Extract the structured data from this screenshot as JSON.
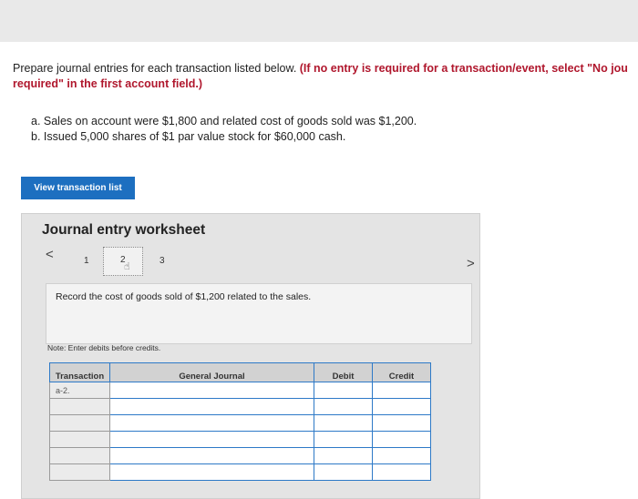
{
  "instructions": {
    "text": "Prepare journal entries for each transaction listed below. ",
    "emphasis_line1": "(If no entry is required for a transaction/event, select \"No jou",
    "emphasis_line2": "required\" in the first account field.)"
  },
  "transactions": [
    "a. Sales on account were $1,800 and related cost of goods sold was $1,200.",
    "b. Issued 5,000 shares of $1 par value stock for $60,000 cash."
  ],
  "view_button_label": "View transaction list",
  "worksheet": {
    "title": "Journal entry worksheet",
    "nav_prev": "<",
    "nav_next": ">",
    "steps": [
      "1",
      "2",
      "3"
    ],
    "current_step": 2,
    "description": "Record the cost of goods sold of $1,200 related to the sales.",
    "note": "Note: Enter debits before credits."
  },
  "journal_table": {
    "headers": [
      "Transaction",
      "General Journal",
      "Debit",
      "Credit"
    ],
    "rows": [
      {
        "transaction": "a-2.",
        "account": "",
        "debit": "",
        "credit": ""
      },
      {
        "transaction": "",
        "account": "",
        "debit": "",
        "credit": ""
      },
      {
        "transaction": "",
        "account": "",
        "debit": "",
        "credit": ""
      },
      {
        "transaction": "",
        "account": "",
        "debit": "",
        "credit": ""
      },
      {
        "transaction": "",
        "account": "",
        "debit": "",
        "credit": ""
      },
      {
        "transaction": "",
        "account": "",
        "debit": "",
        "credit": ""
      }
    ]
  },
  "icons": {
    "hand_cursor": "hand-pointer-icon"
  },
  "colors": {
    "accent_blue": "#1d6fc0",
    "emphasis_red": "#b0172d"
  }
}
